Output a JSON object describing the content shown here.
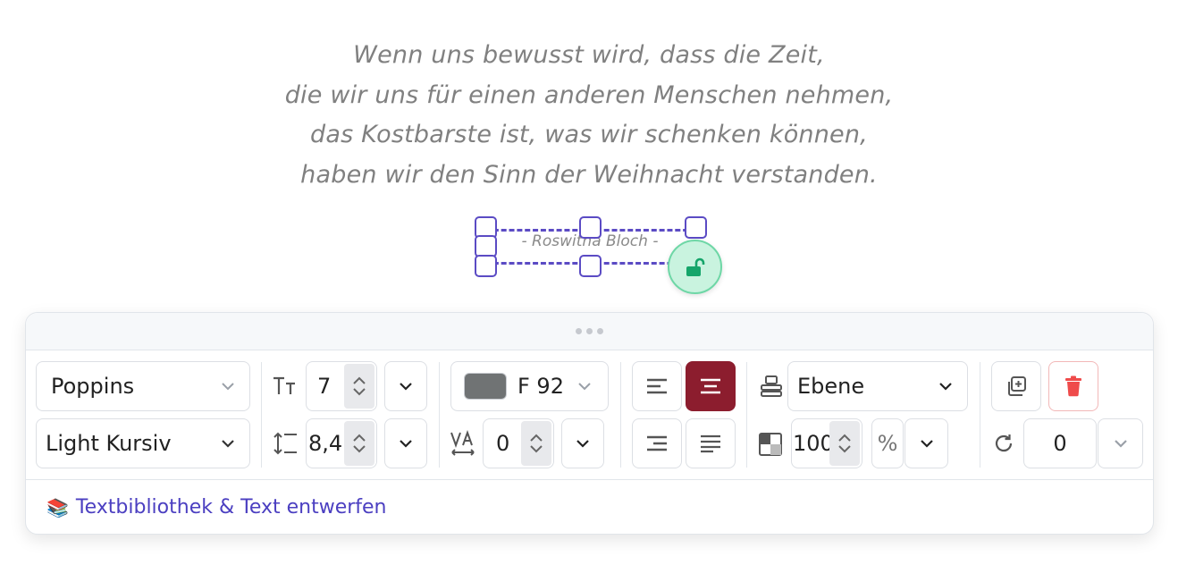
{
  "quote": {
    "lines": [
      "Wenn uns bewusst wird, dass die Zeit,",
      "die wir uns für einen anderen Menschen nehmen,",
      "das Kostbarste ist, was wir schenken können,",
      "haben wir den Sinn der Weihnacht verstanden."
    ],
    "author": "- Roswitha Bloch -"
  },
  "toolbar": {
    "font_family": "Poppins",
    "font_style": "Light Kursiv",
    "font_size": "7",
    "line_height": "8,4",
    "color_label": "F 92",
    "color_swatch": "#707374",
    "letter_spacing": "0",
    "layer": "Ebene",
    "opacity": "100",
    "opacity_unit": "%",
    "rotation": "0",
    "active_align": "center",
    "accent": "#8c1d2e"
  },
  "footer": {
    "emoji": "📚",
    "link_text": "Textbibliothek & Text entwerfen"
  },
  "icons": [
    "font-size-icon",
    "line-height-icon",
    "letter-spacing-icon",
    "align-left-icon",
    "align-center-icon",
    "align-right-icon",
    "align-justify-icon",
    "layer-icon",
    "opacity-icon",
    "rotate-icon",
    "duplicate-icon",
    "trash-icon",
    "unlock-icon",
    "chevron-down-icon"
  ]
}
